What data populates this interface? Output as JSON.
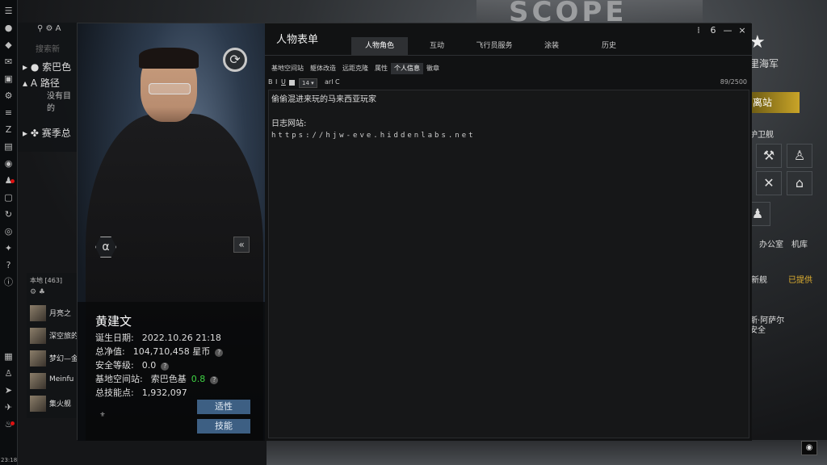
{
  "background": {
    "billboard_text": "SCOPE"
  },
  "neocom": {
    "time": "23:18"
  },
  "route_panel": {
    "search_placeholder": "搜索新",
    "system_row": "索巴色",
    "route_row": "路径",
    "route_sub": "没有目的",
    "season_row": "赛季总"
  },
  "chat_panel": {
    "header": "本地 [463]",
    "members": [
      {
        "name": "月亮之"
      },
      {
        "name": "深空旅的"
      },
      {
        "name": "梦幻—金"
      },
      {
        "name": "Meinfu"
      },
      {
        "name": "集火舰"
      }
    ]
  },
  "right_panel": {
    "faction": "里海军",
    "undock": "离站",
    "service1": "护卫舰",
    "office": "办公室",
    "hangar": "机库",
    "new_item": "新舰",
    "provided": "已提供",
    "agent_name": "斯·阿萨尔",
    "agent_sub": "安全"
  },
  "sheet": {
    "window_title": "人物表单",
    "main_tabs": [
      "人物角色",
      "互动",
      "飞行员服务",
      "涂装",
      "历史"
    ],
    "sub_tabs": [
      "基地空间站",
      "躯体改造",
      "远距克隆",
      "属性",
      "个人信息",
      "徽章"
    ],
    "toolbar": {
      "font_size": "14",
      "font_name": "arl C",
      "counter": "89/2500"
    },
    "editor_lines": [
      "偷偷混进来玩的马来西亚玩家",
      "",
      "日志网站:",
      "https://hjw-eve.hiddenlabs.net"
    ],
    "window_controls": [
      "6",
      "—",
      "×"
    ]
  },
  "character": {
    "name": "黄建文",
    "birth_label": "诞生日期:",
    "birth_value": "2022.10.26 21:18",
    "networth_label": "总净值:",
    "networth_value": "104,710,458 星币",
    "security_label": "安全等级:",
    "security_value": "0.0",
    "station_label": "基地空间站:",
    "station_value": "索巴色基",
    "station_sec": "0.8",
    "sp_label": "总技能点:",
    "sp_value": "1,932,097",
    "btn_aptitude": "适性",
    "btn_skills": "技能",
    "alpha": "α"
  },
  "colors": {
    "accent_button": "#3d5f83",
    "security_green": "#3fd444",
    "undock": "#c9a428"
  }
}
